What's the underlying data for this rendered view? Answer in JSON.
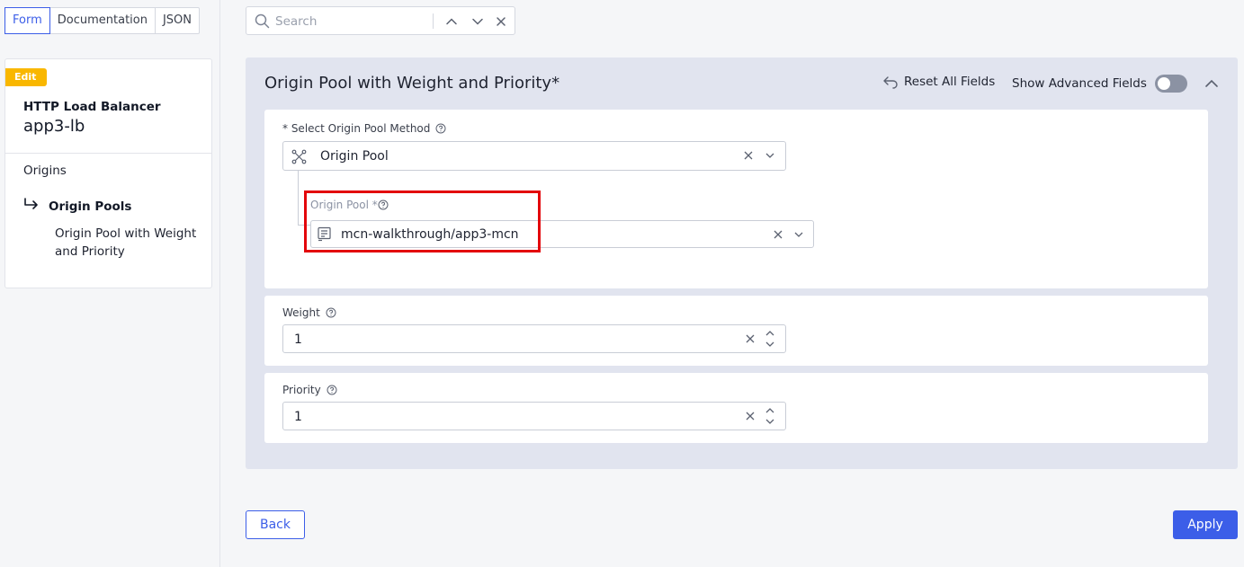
{
  "tabs": [
    "Form",
    "Documentation",
    "JSON"
  ],
  "sidebar": {
    "badge": "Edit",
    "title": "HTTP Load Balancer",
    "name": "app3-lb",
    "nav_origins": "Origins",
    "nav_pools": "Origin Pools",
    "nav_sub": "Origin Pool with Weight and Priority"
  },
  "search": {
    "placeholder": "Search"
  },
  "section": {
    "title": "Origin Pool with Weight and Priority*",
    "reset_label": "Reset All Fields",
    "advanced_label": "Show Advanced Fields",
    "advanced_enabled": false
  },
  "method": {
    "label": "* Select Origin Pool Method",
    "value": "Origin Pool"
  },
  "origin_pool": {
    "label": "Origin Pool *",
    "value": "mcn-walkthrough/app3-mcn"
  },
  "weight": {
    "label": "Weight",
    "value": "1"
  },
  "priority": {
    "label": "Priority",
    "value": "1"
  },
  "buttons": {
    "back": "Back",
    "apply": "Apply"
  },
  "colors": {
    "accent": "#3c5ee8",
    "badge": "#f9b700",
    "highlight": "#e3050b"
  }
}
